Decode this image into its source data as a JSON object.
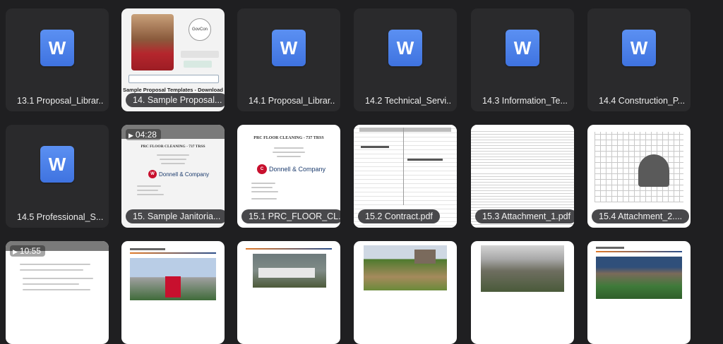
{
  "grid": {
    "row1": [
      {
        "kind": "word",
        "caption": "13.1 Proposal_Librar..."
      },
      {
        "kind": "preview",
        "caption": "14. Sample Proposal...",
        "preview_title": "Sample Proposal Templates - Download",
        "preview_badge": "GovCon"
      },
      {
        "kind": "word",
        "caption": "14.1 Proposal_Librar..."
      },
      {
        "kind": "word",
        "caption": "14.2 Technical_Servi..."
      },
      {
        "kind": "word",
        "caption": "14.3 Information_Te..."
      },
      {
        "kind": "word",
        "caption": "14.4 Construction_P..."
      }
    ],
    "row2": [
      {
        "kind": "word",
        "caption": "14.5 Professional_S..."
      },
      {
        "kind": "video",
        "caption": "15. Sample Janitoria...",
        "duration": "04:28",
        "doc_title": "PRC FLOOR CLEANING - 737 TRSS",
        "company": "Donnell & Company"
      },
      {
        "kind": "doc",
        "caption": "15.1 PRC_FLOOR_CL...",
        "doc_title": "PRC FLOOR CLEANING - 737 TRSS",
        "company": "Donnell & Company"
      },
      {
        "kind": "doc",
        "caption": "15.2 Contract.pdf"
      },
      {
        "kind": "doc",
        "caption": "15.3 Attachment_1.pdf"
      },
      {
        "kind": "doc",
        "caption": "15.4 Attachment_2...."
      }
    ],
    "row3": [
      {
        "kind": "video",
        "duration": "10:55"
      },
      {
        "kind": "doc"
      },
      {
        "kind": "doc"
      },
      {
        "kind": "doc"
      },
      {
        "kind": "doc"
      },
      {
        "kind": "doc"
      }
    ]
  },
  "word_glyph": "W",
  "play_glyph": "▶",
  "colors": {
    "background": "#1f1f21",
    "tile": "#2a2a2c",
    "word_blue": "#4a7fe9",
    "pill": "#48484b"
  }
}
